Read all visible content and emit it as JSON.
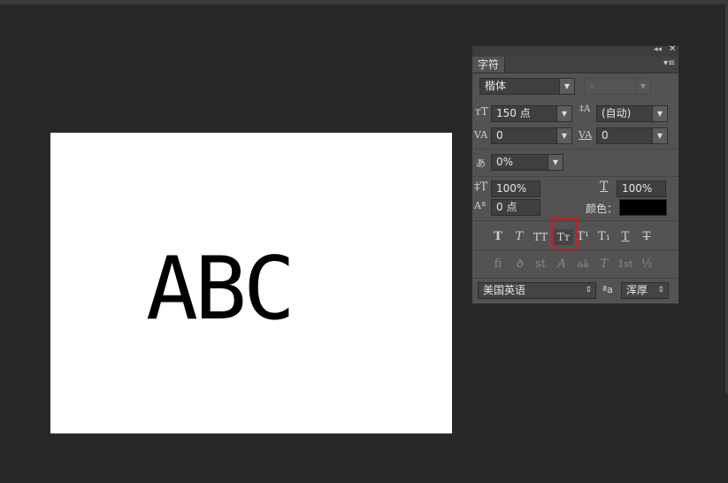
{
  "canvas": {
    "text": "ABC"
  },
  "panel": {
    "tab_label": "字符",
    "font_family": "楷体",
    "font_style": "-",
    "font_size": "150 点",
    "leading": "(自动)",
    "kerning": "0",
    "tracking": "0",
    "tsume": "0%",
    "vertical_scale": "100%",
    "horizontal_scale": "100%",
    "baseline_shift": "0 点",
    "color_label": "颜色：",
    "color_value": "#000000",
    "type_buttons": [
      "T",
      "T",
      "TT",
      "Tт",
      "T¹",
      "T₁",
      "T",
      "T"
    ],
    "opentype_buttons": [
      "fi",
      "ꝺ",
      "st",
      "A",
      "aā",
      "T",
      "1st",
      "½"
    ],
    "language": "美国英语",
    "aa_label": "ªa",
    "antialias": "浑厚",
    "highlighted_button": "small-caps-button"
  },
  "icons": {
    "collapse": "double-chevron-left-icon",
    "close": "close-icon",
    "menu": "panel-menu-icon"
  }
}
